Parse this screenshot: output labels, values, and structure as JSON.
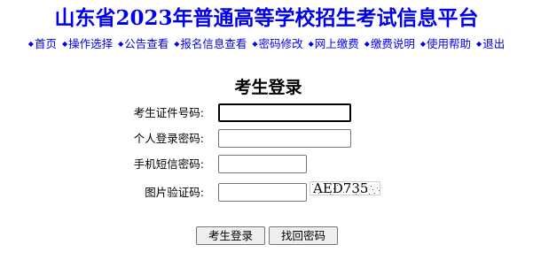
{
  "header": {
    "title": "山东省2023年普通高等学校招生考试信息平台"
  },
  "nav": {
    "bullet": "◆",
    "items": [
      {
        "label": "首页"
      },
      {
        "label": "操作选择"
      },
      {
        "label": "公告查看"
      },
      {
        "label": "报名信息查看"
      },
      {
        "label": "密码修改"
      },
      {
        "label": "网上缴费"
      },
      {
        "label": "缴费说明"
      },
      {
        "label": "使用帮助"
      },
      {
        "label": "退出"
      }
    ]
  },
  "login": {
    "title": "考生登录",
    "fields": {
      "id_number": {
        "label": "考生证件号码:",
        "value": "",
        "focused": true
      },
      "password": {
        "label": "个人登录密码:",
        "value": ""
      },
      "sms_code": {
        "label": "手机短信密码:",
        "value": ""
      },
      "captcha": {
        "label": "图片验证码:",
        "value": ""
      }
    },
    "captcha_image_text": "AED735",
    "buttons": {
      "login": "考生登录",
      "recover": "找回密码"
    }
  },
  "colors": {
    "title": "#0000ee",
    "nav_link": "#0000ee",
    "text": "#000000",
    "background": "#ffffff"
  }
}
